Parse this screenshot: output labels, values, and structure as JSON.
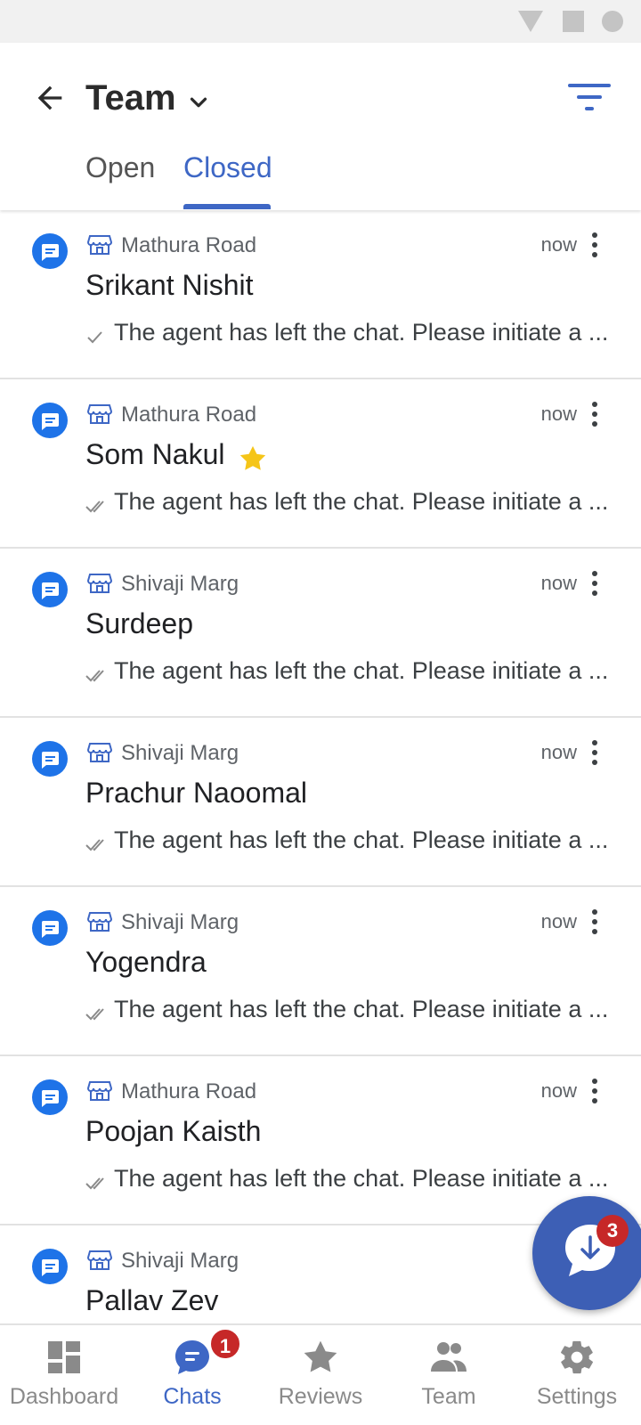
{
  "header": {
    "title": "Team",
    "tabs": [
      {
        "label": "Open",
        "active": false
      },
      {
        "label": "Closed",
        "active": true
      }
    ]
  },
  "chats": [
    {
      "location": "Mathura Road",
      "time": "now",
      "name": "Srikant Nishit",
      "starred": false,
      "preview": "The agent has left the chat. Please initiate a ...",
      "tick": "single"
    },
    {
      "location": "Mathura Road",
      "time": "now",
      "name": "Som Nakul",
      "starred": true,
      "preview": "The agent has left the chat. Please initiate a ...",
      "tick": "double"
    },
    {
      "location": "Shivaji Marg",
      "time": "now",
      "name": "Surdeep",
      "starred": false,
      "preview": "The agent has left the chat. Please initiate a ...",
      "tick": "double"
    },
    {
      "location": "Shivaji Marg",
      "time": "now",
      "name": "Prachur Naoomal",
      "starred": false,
      "preview": "The agent has left the chat. Please initiate a ...",
      "tick": "double"
    },
    {
      "location": "Shivaji Marg",
      "time": "now",
      "name": "Yogendra",
      "starred": false,
      "preview": "The agent has left the chat. Please initiate a ...",
      "tick": "double"
    },
    {
      "location": "Mathura Road",
      "time": "now",
      "name": "Poojan Kaisth",
      "starred": false,
      "preview": "The agent has left the chat. Please initiate a ...",
      "tick": "double"
    },
    {
      "location": "Shivaji Marg",
      "time": "",
      "name": "Pallav Zev",
      "starred": false,
      "preview": "",
      "tick": "none"
    }
  ],
  "fab": {
    "badge": "3"
  },
  "bottom_nav": {
    "items": [
      {
        "label": "Dashboard",
        "icon": "dashboard-icon",
        "active": false
      },
      {
        "label": "Chats",
        "icon": "chats-icon",
        "active": true
      },
      {
        "label": "Reviews",
        "icon": "star-icon",
        "active": false
      },
      {
        "label": "Team",
        "icon": "people-icon",
        "active": false
      },
      {
        "label": "Settings",
        "icon": "gear-icon",
        "active": false
      }
    ],
    "chats_badge": "1"
  },
  "colors": {
    "accent": "#3e67c5",
    "badge": "#c62828",
    "star": "#f5c518",
    "chat_icon": "#1e73e8",
    "fab": "#3d5fb5"
  }
}
